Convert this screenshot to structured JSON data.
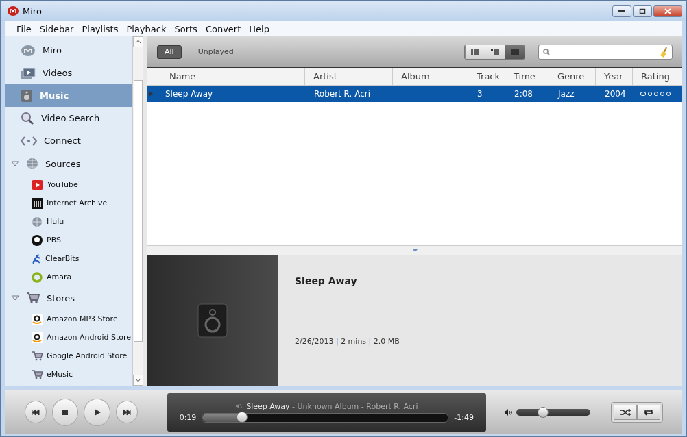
{
  "window": {
    "title": "Miro"
  },
  "menu": [
    "File",
    "Sidebar",
    "Playlists",
    "Playback",
    "Sorts",
    "Convert",
    "Help"
  ],
  "sidebar": {
    "items": [
      {
        "kind": "top",
        "label": "Miro",
        "selected": false
      },
      {
        "kind": "top",
        "label": "Videos",
        "selected": false
      },
      {
        "kind": "top",
        "label": "Music",
        "selected": true
      },
      {
        "kind": "top",
        "label": "Video Search",
        "selected": false
      },
      {
        "kind": "top",
        "label": "Connect",
        "selected": false
      },
      {
        "kind": "group",
        "label": "Sources",
        "expanded": true,
        "children": [
          {
            "label": "YouTube",
            "selected": false
          },
          {
            "label": "Internet Archive",
            "selected": false
          },
          {
            "label": "Hulu",
            "selected": false
          },
          {
            "label": "PBS",
            "selected": false
          },
          {
            "label": "ClearBits",
            "selected": false
          },
          {
            "label": "Amara",
            "selected": false
          }
        ]
      },
      {
        "kind": "group",
        "label": "Stores",
        "expanded": true,
        "children": [
          {
            "label": "Amazon MP3 Store",
            "selected": false
          },
          {
            "label": "Amazon Android Store",
            "selected": false
          },
          {
            "label": "Google Android Store",
            "selected": false
          },
          {
            "label": "eMusic",
            "selected": false
          }
        ]
      }
    ]
  },
  "filters": [
    {
      "label": "All",
      "selected": true
    },
    {
      "label": "Unplayed",
      "selected": false
    }
  ],
  "view_modes": [
    {
      "selected": false
    },
    {
      "selected": false
    },
    {
      "selected": true
    }
  ],
  "table": {
    "columns": [
      "Name",
      "Artist",
      "Album",
      "Track",
      "Time",
      "Genre",
      "Year",
      "Rating"
    ],
    "rows": [
      {
        "selected": true,
        "cells": [
          "Sleep Away",
          "Robert R. Acri",
          "",
          "3",
          "2:08",
          "Jazz",
          "2004"
        ],
        "stars": 0
      }
    ]
  },
  "detail": {
    "title": "Sleep Away",
    "meta": [
      "2/26/2013",
      "2 mins",
      "2.0 MB"
    ],
    "separator": "|"
  },
  "player": {
    "title": "Sleep Away",
    "info": " - Unknown Album - Robert R. Acri",
    "elapsed": "0:19",
    "remaining": "-1:49",
    "level": 0.16,
    "volume": {
      "level": 0.36
    }
  }
}
